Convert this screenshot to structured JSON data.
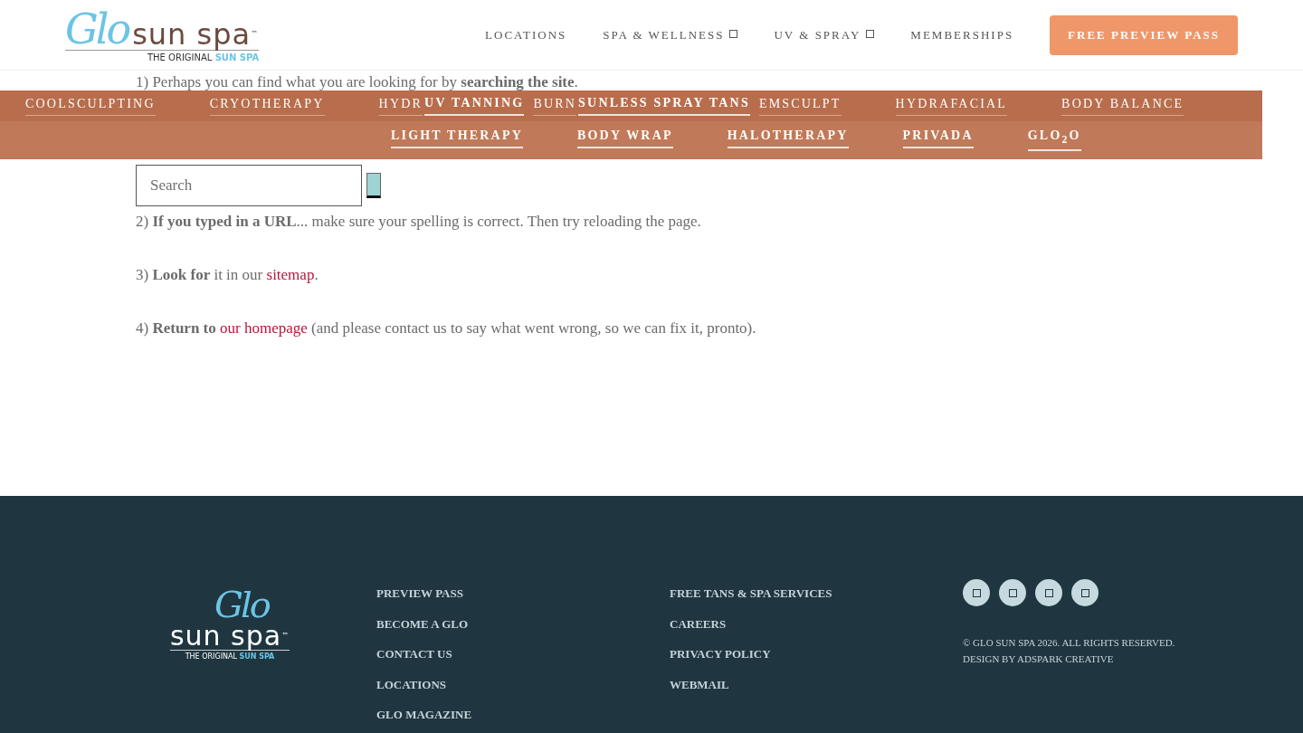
{
  "header": {
    "logo": {
      "script": "Glo",
      "wordmark": "sun spa",
      "tm": "™",
      "tagline": "THE ORIGINAL",
      "tagline_accent": "SUN SPA"
    },
    "nav": [
      {
        "label": "LOCATIONS",
        "dropdown": false
      },
      {
        "label": "SPA & WELLNESS",
        "dropdown": true
      },
      {
        "label": "UV & SPRAY",
        "dropdown": true
      },
      {
        "label": "MEMBERSHIPS",
        "dropdown": false
      }
    ],
    "cta": "FREE PREVIEW PASS"
  },
  "menu_overlay": {
    "rows": [
      {
        "items": [
          {
            "label": "COOLSCULPTING",
            "kind": "faint"
          },
          {
            "label": "CRYOTHERAPY",
            "kind": "faint"
          },
          {
            "label": "HYDR",
            "kind": "faint"
          },
          {
            "label": "UV TANNING",
            "kind": "bright"
          },
          {
            "label": "BURN",
            "kind": "faint"
          },
          {
            "label": "SUNLESS SPRAY TANS",
            "kind": "bright"
          },
          {
            "label": "EMSCULPT",
            "kind": "faint"
          },
          {
            "label": "HYDRAFACIAL",
            "kind": "faint"
          },
          {
            "label": "BODY BALANCE",
            "kind": "faint"
          }
        ]
      },
      {
        "items": [
          {
            "label": "LIGHT THERAPY",
            "kind": "bright"
          },
          {
            "label": "BODY WRAP",
            "kind": "bright"
          },
          {
            "label": "HALOTHERAPY",
            "kind": "bright"
          },
          {
            "label": "PRIVADA",
            "kind": "bright"
          },
          {
            "label": "GLO$_{2}$O",
            "kind": "bright"
          }
        ]
      }
    ]
  },
  "content": {
    "paragraphs": [
      {
        "parts": [
          {
            "text": "1) Perhaps you can find what you are looking for by ",
            "kind": "plain"
          },
          {
            "text": "searching the site",
            "kind": "bold"
          },
          {
            "text": ".",
            "kind": "plain"
          }
        ]
      },
      {
        "parts": [
          {
            "text": "2) ",
            "kind": "plain"
          },
          {
            "text": "If you typed in a URL",
            "kind": "bold"
          },
          {
            "text": "... make sure your spelling is correct. Then try reloading the page.",
            "kind": "plain"
          }
        ]
      },
      {
        "parts": [
          {
            "text": "3) ",
            "kind": "plain"
          },
          {
            "text": "Look for",
            "kind": "bold"
          },
          {
            "text": " it in our ",
            "kind": "plain"
          },
          {
            "text": "sitemap",
            "kind": "link"
          },
          {
            "text": ".",
            "kind": "plain"
          }
        ]
      },
      {
        "parts": [
          {
            "text": "4) ",
            "kind": "plain"
          },
          {
            "text": "Return to ",
            "kind": "bold"
          },
          {
            "text": "our homepage",
            "kind": "link"
          },
          {
            "text": " (and please contact us to say what went wrong, so we can fix it, pronto).",
            "kind": "plain"
          }
        ]
      }
    ],
    "search": {
      "placeholder": "Search"
    }
  },
  "footer": {
    "logo": {
      "script": "Glo",
      "wordmark": "sun spa",
      "tm": "™",
      "tagline": "THE ORIGINAL",
      "tagline_accent": "SUN SPA"
    },
    "columns": [
      [
        "PREVIEW PASS",
        "BECOME A GLO",
        "CONTACT US",
        "LOCATIONS",
        "GLO MAGAZINE"
      ],
      [
        "FREE TANS & SPA SERVICES",
        "CAREERS",
        "PRIVACY POLICY",
        "WEBMAIL"
      ]
    ],
    "copyright": "© GLO SUN SPA 2026. ALL RIGHTS RESERVED.",
    "credit": "DESIGN BY ADSPARK CREATIVE"
  }
}
